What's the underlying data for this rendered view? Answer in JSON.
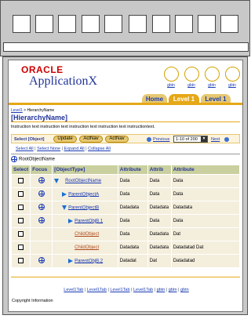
{
  "brand": {
    "oracle": "ORACLE",
    "app": "ApplicationX"
  },
  "global_buttons": [
    "gbtn",
    "gbtn",
    "gbtn",
    "gbtn"
  ],
  "tabs": {
    "home": "Home",
    "level1_active": "Level 1",
    "level1": "Level 1"
  },
  "breadcrumb": {
    "link": "Level1",
    "sep": " > ",
    "current": "HierarchyName"
  },
  "title": "[HierarchyName]",
  "instruction": "Instruction text instruction text instruction text instruction text instructiontext.",
  "controls": {
    "select_label": "Select [Object]",
    "buttons": [
      "Update",
      "ActNav",
      "ActNav"
    ],
    "previous": "Previous",
    "range": "1-10 of 200",
    "next": "Next"
  },
  "selection_links": {
    "select_all": "Select All",
    "select_none": "Select None",
    "expand_all": "Expand All",
    "collapse_all": "Collapse All",
    "sep": " | "
  },
  "root": "RootObjectName",
  "table": {
    "headers": [
      "Select",
      "Focus",
      "[ObjectType]",
      "Attribute",
      "Attrib",
      "Attribute"
    ],
    "rows": [
      {
        "name": "RootObjectName",
        "a1": "Data",
        "a2": "Data",
        "a3": "Data"
      },
      {
        "name": "ParentObjectA",
        "a1": "Data",
        "a2": "Data",
        "a3": "Data"
      },
      {
        "name": "ParentObjectB",
        "a1": "Datadata",
        "a2": "Datadata",
        "a3": "Datadata"
      },
      {
        "name": "ParentObjB.1",
        "a1": "Data",
        "a2": "Data",
        "a3": "Data"
      },
      {
        "name": "ChildObject",
        "a1": "Data",
        "a2": "Datadata",
        "a3": "Dat"
      },
      {
        "name": "ChildObject",
        "a1": "Datadata",
        "a2": "Datadata",
        "a3": "Datadatad Dat"
      },
      {
        "name": "ParentObjB.2",
        "a1": "Datadat",
        "a2": "Dat",
        "a3": "Datadatad"
      }
    ]
  },
  "footer": {
    "links": [
      "Level1Tab",
      "Level1Tab",
      "Level1Tab",
      "Level1Tab",
      "gbtn",
      "gbtn",
      "gbtn"
    ],
    "sep": " | "
  },
  "copyright": "Copyright Information",
  "colors": {
    "accent": "#e6a817",
    "link": "#1a3bb3",
    "header_row": "#c9cf9e",
    "row_bg": "#f4eedd"
  }
}
